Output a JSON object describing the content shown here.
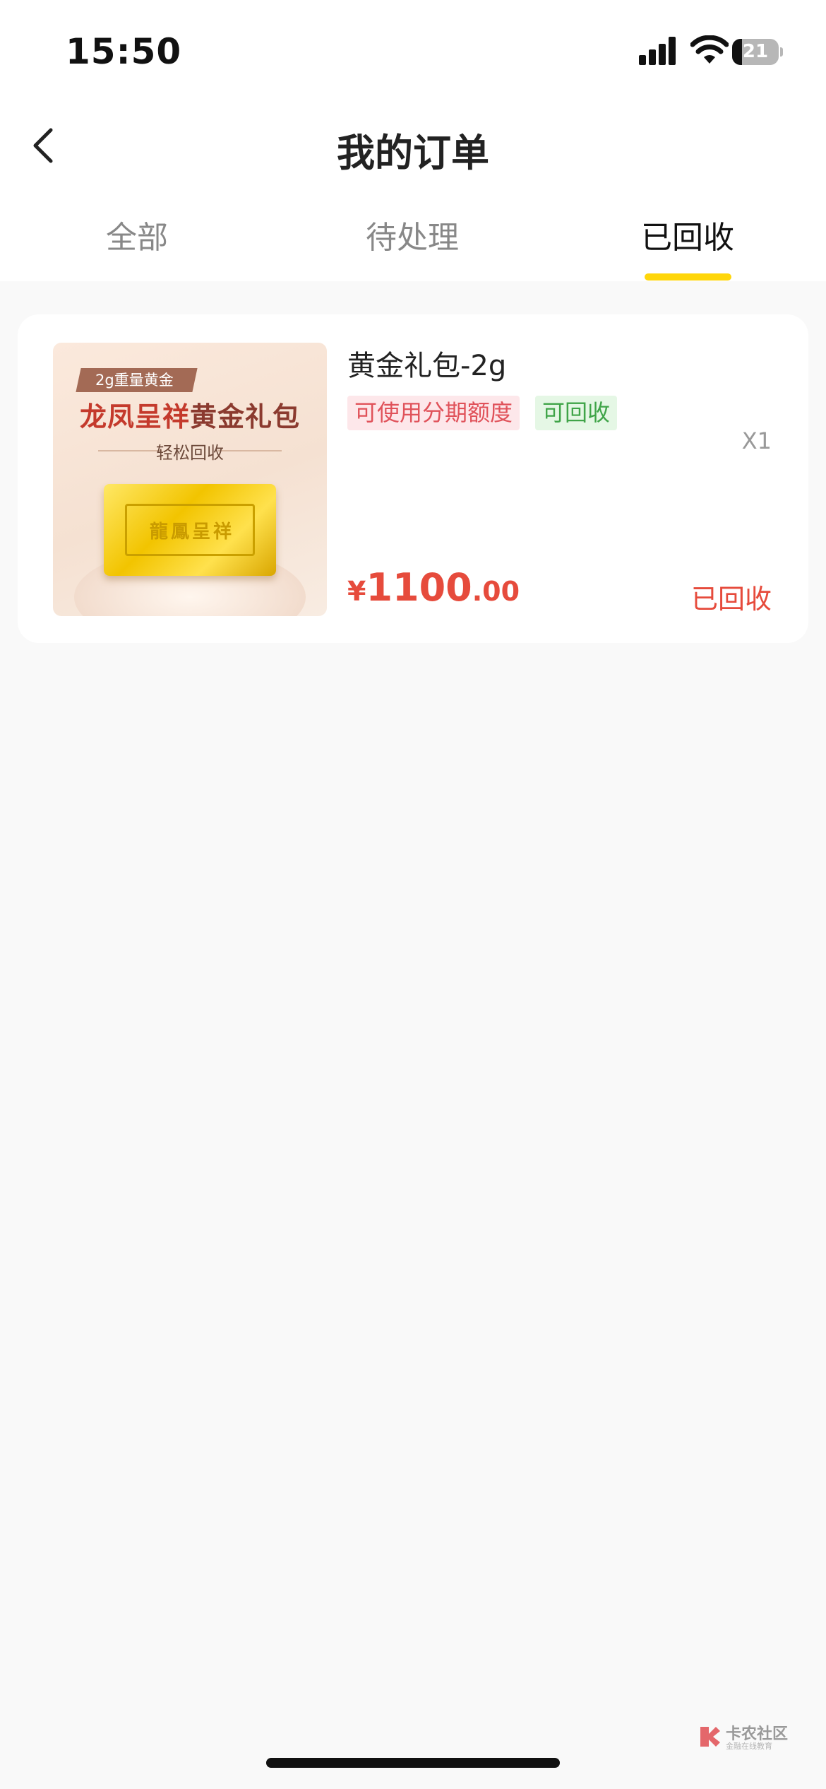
{
  "status_bar": {
    "time": "15:50",
    "battery": "21",
    "battery_level": 0.21
  },
  "header": {
    "title": "我的订单"
  },
  "tabs": [
    {
      "label": "全部",
      "active": false
    },
    {
      "label": "待处理",
      "active": false
    },
    {
      "label": "已回收",
      "active": true
    }
  ],
  "order": {
    "thumbnail": {
      "ribbon": "2g重量黄金",
      "headline_red": "龙凤呈祥",
      "headline_dark": "黄金礼包",
      "subline": "轻松回收",
      "bar_engraving": "龍鳳呈祥"
    },
    "name": "黄金礼包-2g",
    "tags": [
      "可使用分期额度",
      "可回收"
    ],
    "quantity": "X1",
    "price": {
      "currency": "¥",
      "integer": "1100",
      "decimal": ".00"
    },
    "status": "已回收"
  },
  "watermark": {
    "title": "卡农社区",
    "subtitle": "金融在线教育"
  },
  "colors": {
    "accent": "#ffd60a",
    "price": "#e64b3c",
    "tag_red_bg": "#fde7ea",
    "tag_green_bg": "#e5f7e5"
  }
}
